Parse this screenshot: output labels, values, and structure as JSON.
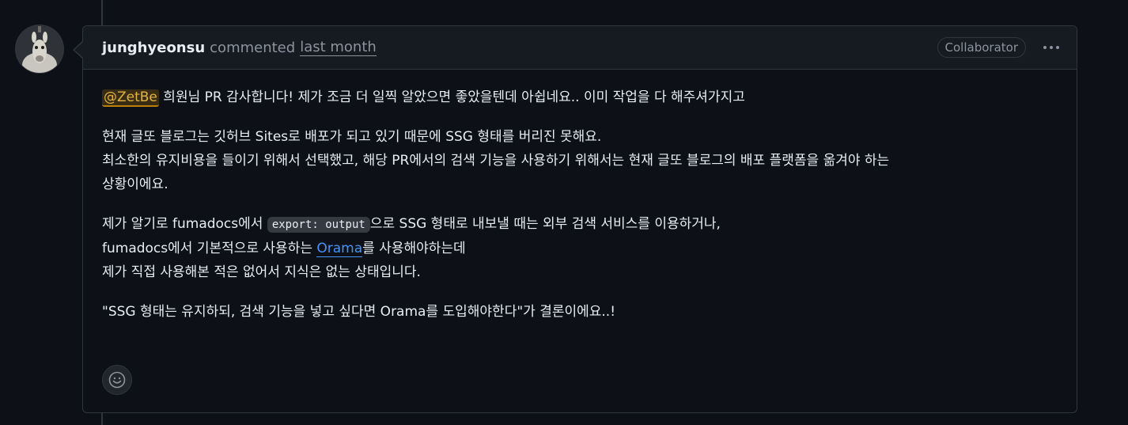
{
  "comment": {
    "author": "junghyeonsu",
    "action": "commented",
    "timestamp": "last month",
    "role_badge": "Collaborator",
    "more_icon": "kebab-horizontal-icon",
    "mention": "@ZetBe",
    "para1_rest": " 희원님 PR 감사합니다! 제가 조금 더 일찍 알았으면 좋았을텐데 아쉽네요.. 이미 작업을 다 해주셔가지고",
    "para2_line1": "현재 글또 블로그는 깃허브 Sites로 배포가 되고 있기 때문에 SSG 형태를 버리진 못해요.",
    "para2_line2": "최소한의 유지비용을 들이기 위해서 선택했고, 해당 PR에서의 검색 기능을 사용하기 위해서는 현재 글또 블로그의 배포 플랫폼을 옮겨야 하는",
    "para2_line3": "상황이에요.",
    "para3_line1_before": "제가 알기로 fumadocs에서 ",
    "para3_code": "export: output",
    "para3_line1_after": "으로 SSG 형태로 내보낼 때는 외부 검색 서비스를 이용하거나,",
    "para3_line2_before": "fumadocs에서 기본적으로 사용하는 ",
    "para3_link": "Orama",
    "para3_line2_after": "를 사용해야하는데",
    "para3_line3": "제가 직접 사용해본 적은 없어서 지식은 없는 상태입니다.",
    "para4": "\"SSG 형태는 유지하되, 검색 기능을 넣고 싶다면 Orama를 도입해야한다\"가 결론이에요..!",
    "reaction_icon": "smiley-icon"
  }
}
